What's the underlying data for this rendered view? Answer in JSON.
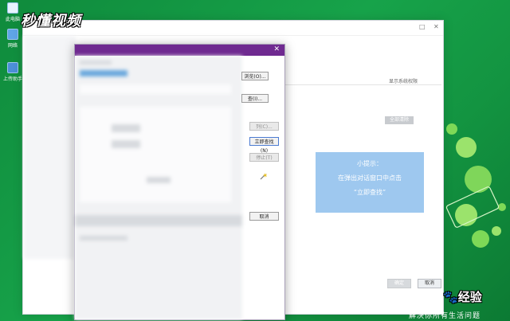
{
  "desktop": {
    "icons": [
      {
        "label": "此电脑",
        "icon": "computer-icon"
      },
      {
        "label": "网络",
        "icon": "network-icon"
      },
      {
        "label": "上传助手",
        "icon": "upload-icon"
      }
    ]
  },
  "brand_top": "秒懂视频",
  "background_window": {
    "show_link": "显示系统权限",
    "clear_button": "全部清除",
    "ok_button": "确定",
    "cancel_button": "取消"
  },
  "dialog": {
    "buttons": {
      "browse": "浏览(O)...",
      "find_unknown": "查(I)...",
      "advanced": "列(C)...",
      "find_now": "立即查找(N)",
      "stop": "停止(T)",
      "cancel": "取消"
    }
  },
  "tip": {
    "line1": "小提示：",
    "line2": "在弹出对话窗口中点击",
    "line3": "“立即查找”"
  },
  "brand_bottom": {
    "title": "经验",
    "subtitle": "解决你所有生活问题"
  },
  "colors": {
    "desktop_green": "#139441",
    "dialog_title": "#6f2a90",
    "tip_bg": "#9ec8ef"
  }
}
